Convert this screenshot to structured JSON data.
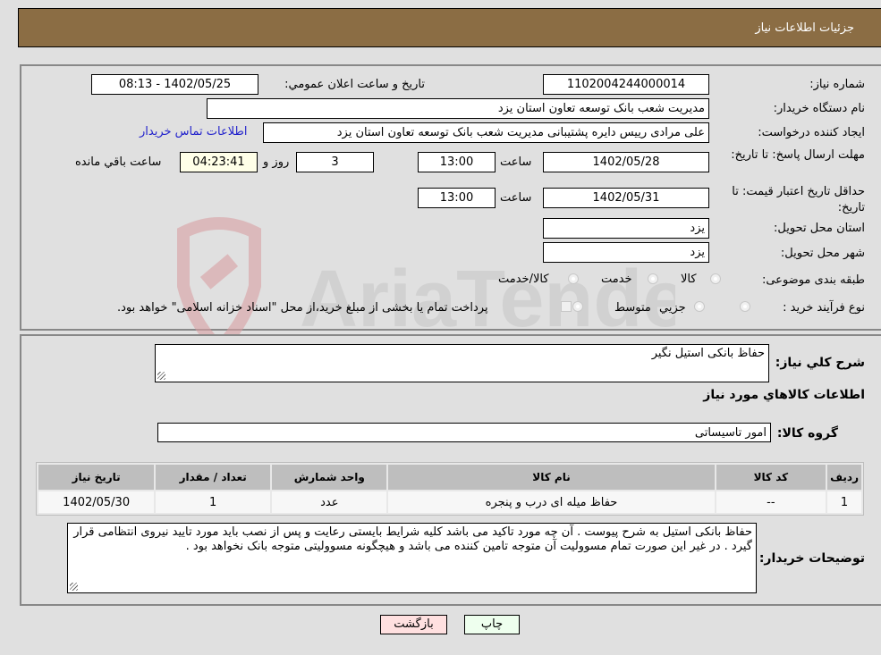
{
  "header": {
    "title": "جزئيات اطلاعات نياز"
  },
  "details": {
    "need_number": {
      "label": "شماره نیاز:",
      "value": "1102004244000014"
    },
    "announce_datetime": {
      "label": "تاریخ و ساعت اعلان عمومي:",
      "value": "1402/05/25 - 08:13"
    },
    "buyer_org": {
      "label": "نام دستگاه خریدار:",
      "value": "مدیریت شعب بانک توسعه تعاون استان یزد"
    },
    "requester": {
      "label": "ایجاد کننده درخواست:",
      "value": "علی مرادی رییس دایره پشتیبانی مدیریت شعب بانک توسعه تعاون استان یزد",
      "contact_link": "اطلاعات تماس خریدار"
    },
    "reply_deadline": {
      "label": "مهلت ارسال پاسخ: تا تاریخ:",
      "date": "1402/05/28",
      "time_label": "ساعت",
      "time": "13:00",
      "days": "3",
      "days_label": "روز و",
      "remaining": "04:23:41",
      "remaining_label": "ساعت باقي مانده"
    },
    "price_validity": {
      "label": "حداقل تاریخ اعتبار قیمت: تا تاریخ:",
      "date": "1402/05/31",
      "time_label": "ساعت",
      "time": "13:00"
    },
    "delivery_province": {
      "label": "استان محل تحویل:",
      "value": "یزد"
    },
    "delivery_city": {
      "label": "شهر محل تحویل:",
      "value": "یزد"
    },
    "category": {
      "label": "طبقه بندی موضوعی:",
      "options": [
        "کالا",
        "خدمت",
        "کالا/خدمت"
      ]
    },
    "purchase_type": {
      "label": "نوع فرآیند خرید :",
      "options": [
        "جزيي",
        "متوسط"
      ],
      "checkbox_text": "پرداخت تمام یا بخشی از مبلغ خرید،از محل \"اسناد خزانه اسلامی\" خواهد بود."
    }
  },
  "need": {
    "description_label": "شرح كلي نياز:",
    "description": "حفاظ بانکی استیل نگیر",
    "goods_section_title": "اطلاعات كالاهاي مورد نياز",
    "goods_group_label": "گروه کالا:",
    "goods_group": "امور تاسیساتی"
  },
  "items_table": {
    "headers": [
      "ردیف",
      "کد کالا",
      "نام کالا",
      "واحد شمارش",
      "تعداد / مقدار",
      "تاریخ نیاز"
    ],
    "rows": [
      [
        "1",
        "--",
        "حفاظ میله ای درب و پنجره",
        "عدد",
        "1",
        "1402/05/30"
      ]
    ]
  },
  "buyer_notes": {
    "label": "توضیحات خریدار:",
    "text": "حفاظ بانکی استیل به شرح پیوست . آن چه مورد تاکید می باشد کلیه شرایط بایستی رعایت و پس از نصب باید مورد تایید نیروی انتظامی قرار گیرد . در غیر این صورت تمام مسوولیت آن متوجه تامین کننده می باشد و هیچگونه مسوولیتی متوجه بانک نخواهد بود ."
  },
  "buttons": {
    "print": "چاپ",
    "back": "بازگشت"
  },
  "watermark": {
    "text": "AriaTender.neT"
  }
}
